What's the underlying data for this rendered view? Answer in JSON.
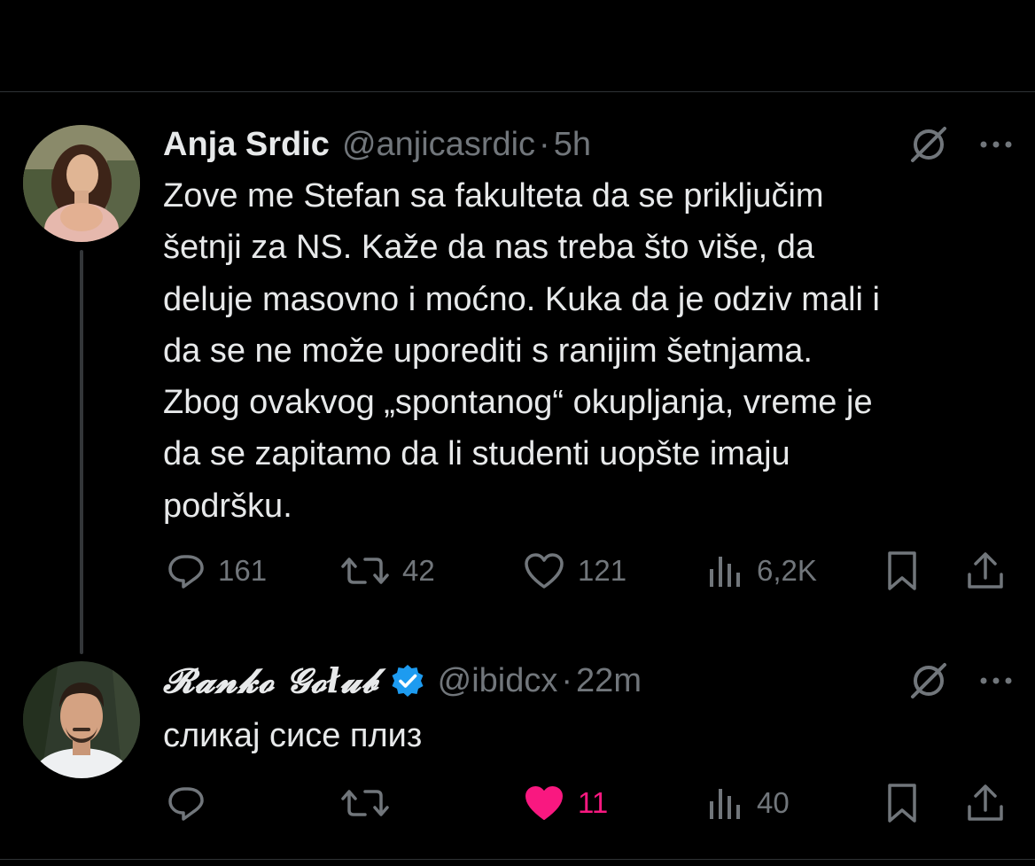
{
  "tweets": [
    {
      "display_name": "Anja Srdic",
      "handle": "@anjicasrdic",
      "separator": "·",
      "time": "5h",
      "text": "Zove me Stefan sa fakulteta da se priključim\nšetnji za NS. Kaže da nas treba što više, da\ndeluje masovno i moćno. Kuka da je odziv mali i\nda se ne može uporediti s ranijim šetnjama.\nZbog ovakvog „spontanog“ okupljanja, vreme je\nda se zapitamo da li studenti uopšte imaju\npodršku.",
      "verified": false,
      "stats": {
        "replies": "161",
        "reposts": "42",
        "likes": "121",
        "views": "6,2K"
      }
    },
    {
      "display_name": "𝓡𝓪𝓷𝓴𝓸 𝓖𝓸ł𝓾𝓫",
      "handle": "@ibidcx",
      "separator": "·",
      "time": "22m",
      "text": "сликај сисе плиз",
      "verified": true,
      "liked": true,
      "stats": {
        "replies": "",
        "reposts": "",
        "likes": "11",
        "views": "40"
      }
    }
  ],
  "icons": {
    "reply": "reply-icon",
    "repost": "repost-icon",
    "like": "heart-icon",
    "views": "views-icon",
    "bookmark": "bookmark-icon",
    "share": "share-icon",
    "grok": "grok-icon",
    "more": "more-icon",
    "verified": "verified-badge-icon"
  },
  "colors": {
    "background": "#000000",
    "text": "#e7e9ea",
    "secondary": "#71767b",
    "like_active": "#f91880",
    "verified": "#1d9bf0",
    "divider": "#2f3336"
  }
}
